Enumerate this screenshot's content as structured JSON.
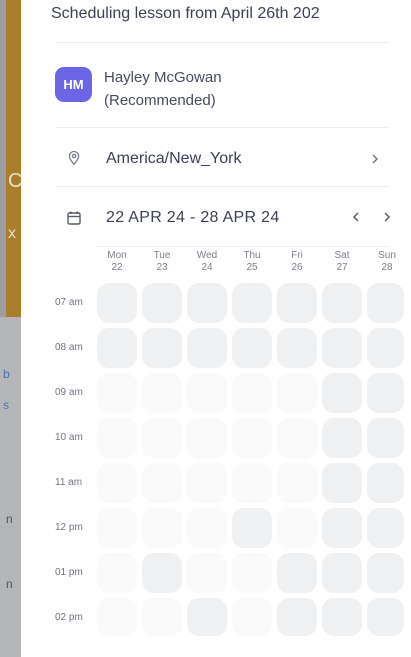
{
  "header": {
    "title": "Scheduling lesson from April 26th 202"
  },
  "tutor": {
    "initials": "HM",
    "name": "Hayley McGowan (Recommended)"
  },
  "timezone": {
    "label": "America/New_York",
    "icon": "location-pin-icon"
  },
  "week": {
    "range": "22 APR 24 - 28 APR 24",
    "icon": "calendar-icon"
  },
  "days": [
    {
      "name": "Mon",
      "date": "22"
    },
    {
      "name": "Tue",
      "date": "23"
    },
    {
      "name": "Wed",
      "date": "24"
    },
    {
      "name": "Thu",
      "date": "25"
    },
    {
      "name": "Fri",
      "date": "26"
    },
    {
      "name": "Sat",
      "date": "27"
    },
    {
      "name": "Sun",
      "date": "28"
    }
  ],
  "times": [
    "07 am",
    "08 am",
    "09 am",
    "10 am",
    "11 am",
    "12 pm",
    "01 pm",
    "02 pm"
  ],
  "slot_states": [
    [
      1,
      1,
      1,
      1,
      1,
      1,
      1
    ],
    [
      1,
      1,
      1,
      1,
      1,
      1,
      1
    ],
    [
      0,
      0,
      0,
      0,
      0,
      1,
      1
    ],
    [
      0,
      0,
      0,
      0,
      0,
      1,
      1
    ],
    [
      0,
      0,
      0,
      0,
      0,
      1,
      1
    ],
    [
      0,
      0,
      0,
      1,
      0,
      1,
      1
    ],
    [
      0,
      1,
      0,
      0,
      1,
      1,
      1
    ],
    [
      0,
      0,
      1,
      0,
      1,
      1,
      1
    ]
  ],
  "colors": {
    "accent": "#6a66e6",
    "slot_unavailable": "#eef0f2",
    "slot_available": "#fafafa"
  },
  "backdrop": {
    "chars": [
      "C",
      "x",
      "b",
      "s",
      "n",
      "n"
    ]
  }
}
